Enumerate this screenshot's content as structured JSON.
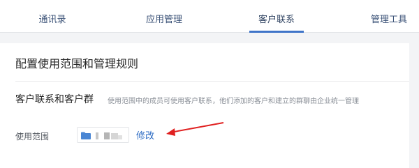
{
  "tabs": [
    {
      "label": "通讯录",
      "active": false
    },
    {
      "label": "应用管理",
      "active": false
    },
    {
      "label": "客户联系",
      "active": true
    },
    {
      "label": "管理工具",
      "active": false
    }
  ],
  "panel": {
    "title": "配置使用范围和管理规则",
    "section": {
      "label": "客户联系和客户群",
      "description": "使用范围中的成员可使用客户联系，他们添加的客户和建立的群聊由企业统一管理"
    },
    "scope": {
      "label": "使用范围",
      "value_icon": "folder-icon",
      "value_obscured": true,
      "modify_label": "修改"
    }
  },
  "colors": {
    "accent": "#3f74c8",
    "link": "#2d6cc4",
    "annotation_arrow": "#e02020"
  }
}
